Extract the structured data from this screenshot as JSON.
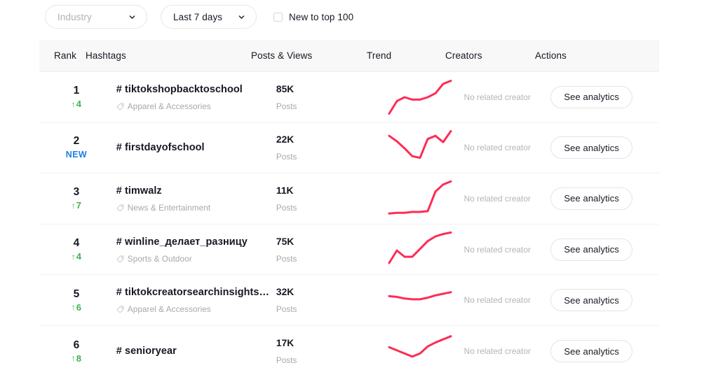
{
  "filters": {
    "industry": {
      "label": "Industry",
      "icon": "chevron-down-icon"
    },
    "period": {
      "label": "Last 7 days",
      "icon": "chevron-down-icon"
    },
    "new_to_top": {
      "label": "New to top 100",
      "checked": false
    }
  },
  "table": {
    "headers": {
      "rank": "Rank",
      "hashtags": "Hashtags",
      "posts_views": "Posts & Views",
      "trend": "Trend",
      "creators": "Creators",
      "actions": "Actions"
    },
    "action_label": "See analytics",
    "rows": [
      {
        "rank": "1",
        "rank_delta": "4",
        "rank_arrow": "↑",
        "badge": "",
        "hashtag": "# tiktokshopbacktoschool",
        "category": "Apparel & Accessories",
        "posts_value": "85K",
        "posts_label": "Posts",
        "creators": "No related creator",
        "action": "See analytics",
        "trend_points": [
          4,
          20,
          25,
          22,
          22,
          25,
          30,
          42,
          46
        ]
      },
      {
        "rank": "2",
        "rank_delta": "",
        "rank_arrow": "",
        "badge": "NEW",
        "hashtag": "# firstdayofschool",
        "category": "",
        "posts_value": "22K",
        "posts_label": "Posts",
        "creators": "No related creator",
        "action": "See analytics",
        "trend_points": [
          40,
          33,
          24,
          14,
          12,
          36,
          40,
          32,
          46
        ]
      },
      {
        "rank": "3",
        "rank_delta": "7",
        "rank_arrow": "↑",
        "badge": "",
        "hashtag": "# timwalz",
        "category": "News & Entertainment",
        "posts_value": "11K",
        "posts_label": "Posts",
        "creators": "No related creator",
        "action": "See analytics",
        "trend_points": [
          6,
          7,
          7,
          8,
          8,
          9,
          34,
          43,
          47
        ]
      },
      {
        "rank": "4",
        "rank_delta": "4",
        "rank_arrow": "↑",
        "badge": "",
        "hashtag": "# winline_делает_разницу",
        "category": "Sports & Outdoor",
        "posts_value": "75K",
        "posts_label": "Posts",
        "creators": "No related creator",
        "action": "See analytics",
        "trend_points": [
          8,
          24,
          16,
          16,
          26,
          36,
          42,
          45,
          47
        ]
      },
      {
        "rank": "5",
        "rank_delta": "6",
        "rank_arrow": "↑",
        "badge": "",
        "hashtag": "# tiktokcreatorsearchinsights…",
        "category": "Apparel & Accessories",
        "posts_value": "32K",
        "posts_label": "Posts",
        "creators": "No related creator",
        "action": "See analytics",
        "trend_points": [
          30,
          29,
          27,
          26,
          26,
          28,
          31,
          33,
          35
        ]
      },
      {
        "rank": "6",
        "rank_delta": "8",
        "rank_arrow": "↑",
        "badge": "",
        "hashtag": "# senioryear",
        "category": "",
        "posts_value": "17K",
        "posts_label": "Posts",
        "creators": "No related creator",
        "action": "See analytics",
        "trend_points": [
          30,
          26,
          22,
          18,
          22,
          31,
          36,
          40,
          44
        ]
      }
    ]
  },
  "colors": {
    "accent_line": "#fe2c55",
    "rank_up": "#3eb34f",
    "new_badge": "#1d7dea",
    "text_primary": "#161823",
    "text_muted": "#a8a8ad"
  }
}
